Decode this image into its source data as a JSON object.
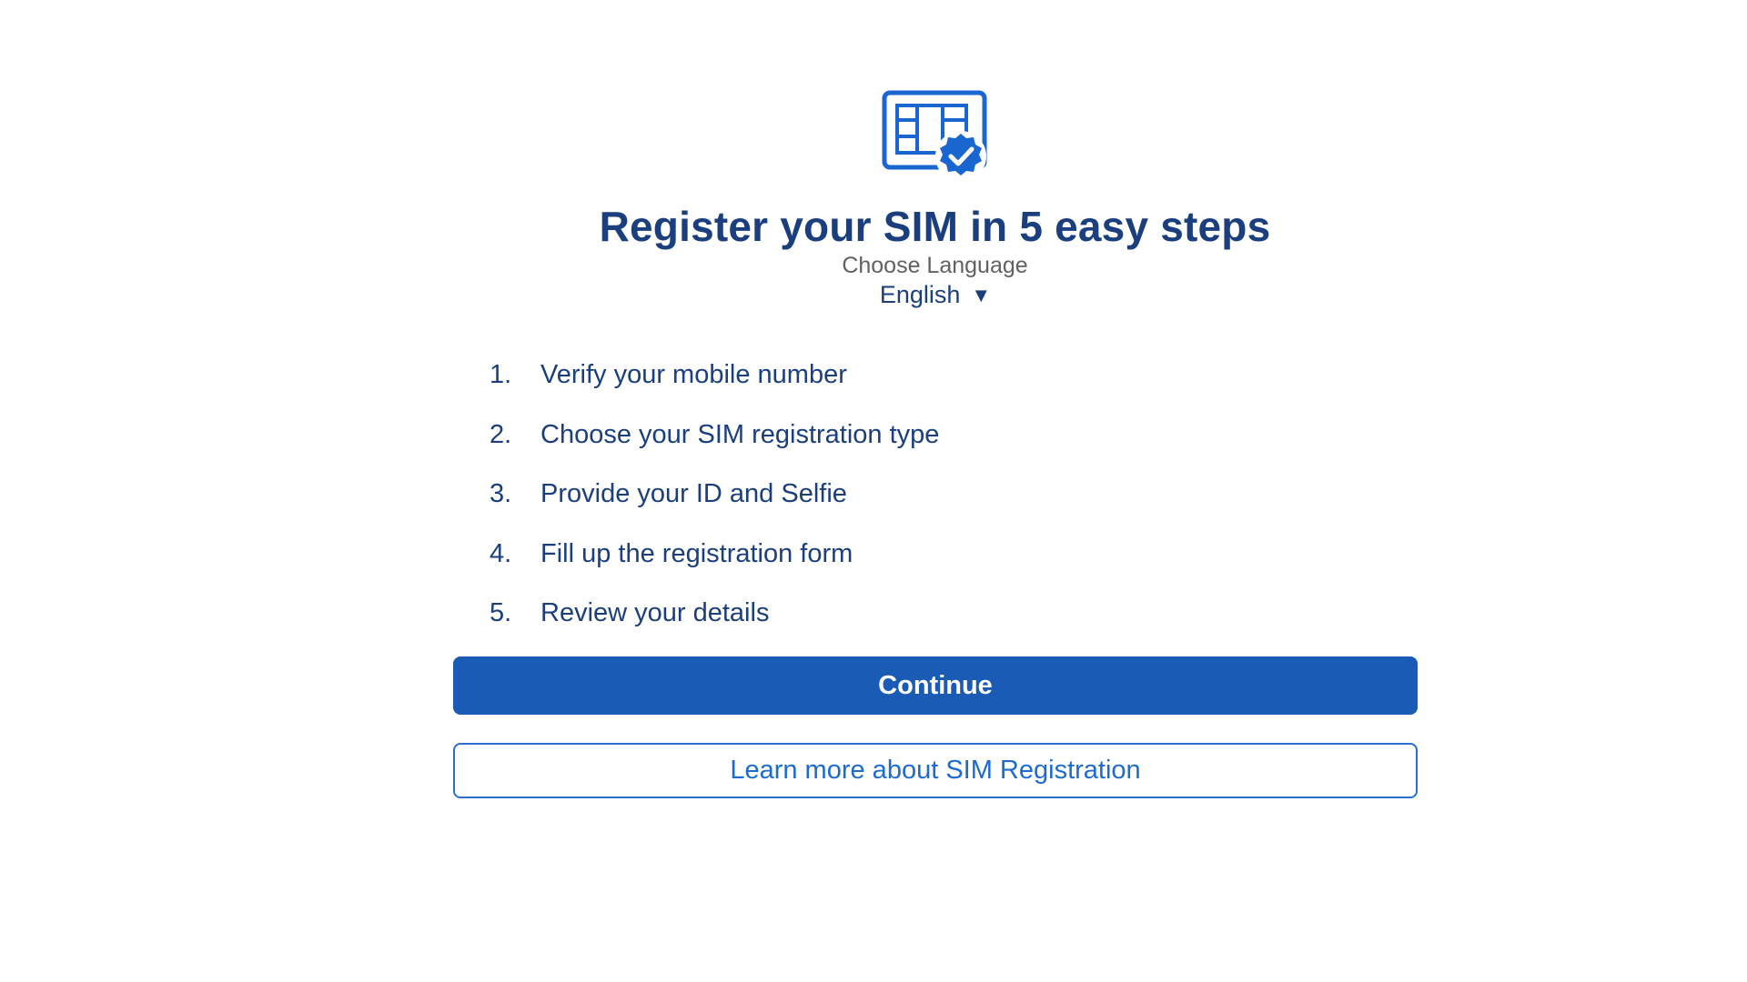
{
  "header": {
    "title": "Register your SIM in 5 easy steps",
    "logo_icon": "sim-card-check-icon"
  },
  "language": {
    "label": "Choose Language",
    "selected": "English",
    "caret": "▼"
  },
  "steps": [
    {
      "number": "1.",
      "label": "Verify your mobile number"
    },
    {
      "number": "2.",
      "label": "Choose your SIM registration type"
    },
    {
      "number": "3.",
      "label": "Provide your ID and Selfie"
    },
    {
      "number": "4.",
      "label": "Fill up the registration form"
    },
    {
      "number": "5.",
      "label": "Review your details"
    }
  ],
  "actions": {
    "continue_label": "Continue",
    "learn_more_label": "Learn more about SIM Registration"
  },
  "colors": {
    "primary": "#1a5bb5",
    "text_dark_blue": "#1b3f7e",
    "link_blue": "#1e6bd0",
    "muted_gray": "#616161"
  }
}
